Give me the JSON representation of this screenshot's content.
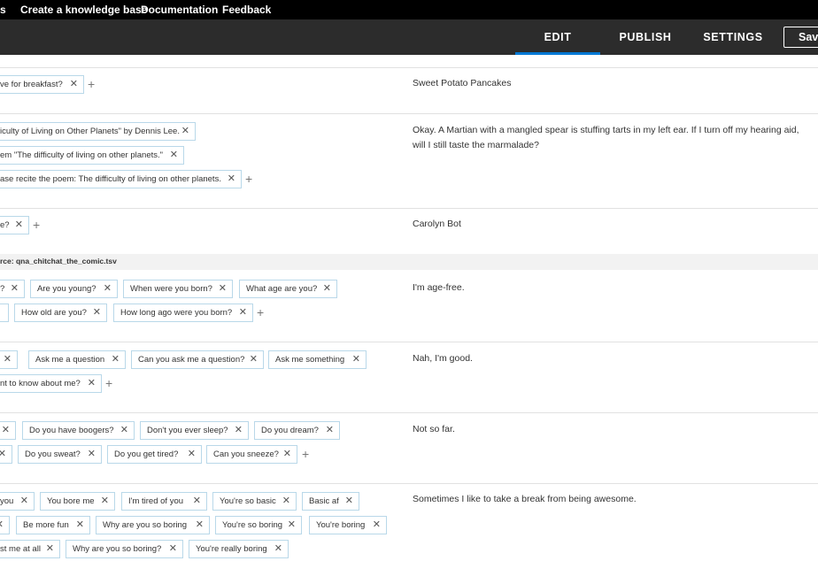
{
  "topnav": {
    "items": [
      "s",
      "Create a knowledge base",
      "Documentation",
      "Feedback"
    ]
  },
  "subnav": {
    "tabs": [
      "EDIT",
      "PUBLISH",
      "SETTINGS"
    ],
    "active_tab": "EDIT",
    "save_label": "Save"
  },
  "source_label": "rce: qna_chitchat_the_comic.tsv",
  "qna": [
    {
      "questions": [
        "ve for breakfast?"
      ],
      "answer": "Sweet Potato Pancakes"
    },
    {
      "questions": [
        "iculty of Living on Other Planets\" by Dennis Lee.",
        "em \"The difficulty of living on other planets.\"",
        "ase recite the poem: The difficulty of living on other planets."
      ],
      "answer": "Okay. A Martian with a mangled spear is stuffing tarts in my left ear. If I turn off my hearing aid, will I still taste the marmalade?"
    },
    {
      "questions": [
        "e?"
      ],
      "answer": "Carolyn Bot"
    },
    {
      "questions": [
        "?",
        "Are you young?",
        "When were you born?",
        "What age are you?",
        "",
        "How old are you?",
        "How long ago were you born?"
      ],
      "answer": "I'm age-free."
    },
    {
      "questions": [
        "",
        "Ask me a question",
        "Can you ask me a question?",
        "Ask me something",
        "nt to know about me?"
      ],
      "answer": "Nah, I'm good."
    },
    {
      "questions": [
        "",
        "Do you have boogers?",
        "Don't you ever sleep?",
        "Do you dream?",
        "",
        "Do you sweat?",
        "Do you get tired?",
        "Can you sneeze?"
      ],
      "answer": "Not so far."
    },
    {
      "questions": [
        "you",
        "You bore me",
        "I'm tired of you",
        "You're so basic",
        "Basic af",
        "",
        "Be more fun",
        "Why are you so boring",
        "You're so boring",
        "You're boring",
        "st me at all",
        "Why are you so boring?",
        "You're really boring"
      ],
      "answer": "Sometimes I like to take a break from being awesome."
    }
  ]
}
